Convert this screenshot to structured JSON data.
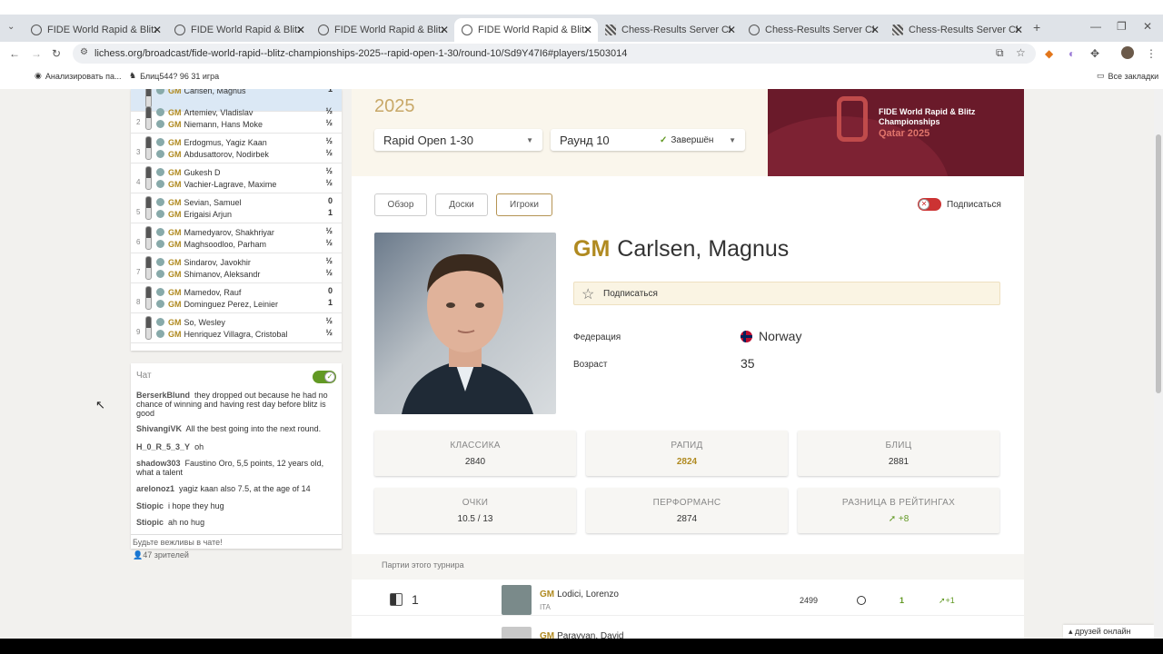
{
  "tabs": [
    {
      "title": "FIDE World Rapid & Blitz Cham",
      "icon": "globe-icon"
    },
    {
      "title": "FIDE World Rapid & Blitz Cham",
      "icon": "globe-icon"
    },
    {
      "title": "FIDE World Rapid & Blitz Cham",
      "icon": "globe-icon"
    },
    {
      "title": "FIDE World Rapid & Blitz Cham",
      "icon": "globe-icon"
    },
    {
      "title": "Chess-Results Server Chess-res",
      "icon": "chess-results-icon"
    },
    {
      "title": "Chess-Results Server Chess-res",
      "icon": "globe-icon"
    },
    {
      "title": "Chess-Results Server Chess-res",
      "icon": "chess-results-icon"
    }
  ],
  "url": "lichess.org/broadcast/fide-world-rapid--blitz-championships-2025--rapid-open-1-30/round-10/Sd9Y47I6#players/1503014",
  "bookmarks": {
    "b1": "Анализировать па...",
    "b2": "Блиц544? 96 31 игра",
    "all": "Все закладки"
  },
  "games": [
    {
      "num": "",
      "w": "Carlsen, Magnus",
      "ws": "1",
      "b": "",
      "bs": ""
    },
    {
      "num": "2",
      "w": "Artemiev, Vladislav",
      "ws": "½",
      "b": "Niemann, Hans Moke",
      "bs": "½"
    },
    {
      "num": "3",
      "w": "Erdogmus, Yagiz Kaan",
      "ws": "½",
      "b": "Abdusattorov, Nodirbek",
      "bs": "½"
    },
    {
      "num": "4",
      "w": "Gukesh D",
      "ws": "½",
      "b": "Vachier-Lagrave, Maxime",
      "bs": "½"
    },
    {
      "num": "5",
      "w": "Sevian, Samuel",
      "ws": "0",
      "b": "Erigaisi Arjun",
      "bs": "1"
    },
    {
      "num": "6",
      "w": "Mamedyarov, Shakhriyar",
      "ws": "½",
      "b": "Maghsoodloo, Parham",
      "bs": "½"
    },
    {
      "num": "7",
      "w": "Sindarov, Javokhir",
      "ws": "½",
      "b": "Shimanov, Aleksandr",
      "bs": "½"
    },
    {
      "num": "8",
      "w": "Mamedov, Rauf",
      "ws": "0",
      "b": "Dominguez Perez, Leinier",
      "bs": "1"
    },
    {
      "num": "9",
      "w": "So, Wesley",
      "ws": "½",
      "b": "Henriquez Villagra, Cristobal",
      "bs": "½"
    }
  ],
  "gm": "GM",
  "chat": {
    "title": "Чат",
    "messages": [
      {
        "user": "BerserkBlund",
        "text": "they dropped out because he had no chance of winning and having rest day before blitz is good"
      },
      {
        "user": "ShivangiVK",
        "text": "All the best going into the next round."
      },
      {
        "user": "H_0_R_5_3_Y",
        "text": "oh"
      },
      {
        "user": "shadow303",
        "text": "Faustino Oro, 5,5 points, 12 years old, what a talent"
      },
      {
        "user": "arelonoz1",
        "text": "yagiz kaan also 7.5, at the age of 14"
      },
      {
        "user": "Stiopic",
        "text": "i hope they hug"
      },
      {
        "user": "Stiopic",
        "text": "ah no hug"
      }
    ],
    "placeholder": "Будьте вежливы в чате!",
    "watchers": "47 зрителей"
  },
  "header": {
    "year": "2025",
    "tournament": "Rapid Open 1-30",
    "round": "Раунд 10",
    "status": "Завершён",
    "banner_title": "FIDE World Rapid & Blitz Championships",
    "banner_sub": "Qatar 2025"
  },
  "nav": {
    "overview": "Обзор",
    "boards": "Доски",
    "players": "Игроки",
    "subscribe": "Подписаться"
  },
  "player": {
    "title": "GM",
    "name": "Carlsen, Magnus",
    "follow": "Подписаться",
    "federation_label": "Федерация",
    "federation": "Norway",
    "age_label": "Возраст",
    "age": "35"
  },
  "ratings": [
    {
      "k": "КЛАССИКА",
      "v": "2840"
    },
    {
      "k": "РАПИД",
      "v": "2824"
    },
    {
      "k": "БЛИЦ",
      "v": "2881"
    },
    {
      "k": "ОЧКИ",
      "v": "10.5 / 13"
    },
    {
      "k": "ПЕРФОРМАНС",
      "v": "2874"
    },
    {
      "k": "РАЗНИЦА В РЕЙТИНГАХ",
      "v": "+8"
    }
  ],
  "games_section": {
    "title": "Партии этого турнира",
    "rows": [
      {
        "round": "1",
        "title": "GM",
        "name": "Lodici, Lorenzo",
        "fed": "ITA",
        "rating": "2499",
        "result": "1",
        "diff": "+1"
      },
      {
        "title": "GM",
        "name": "Paravyan, David"
      }
    ]
  },
  "friends": "друзей онлайн",
  "colors": {
    "gold": "#b08a20",
    "green": "#629924",
    "accent": "#b59453"
  }
}
